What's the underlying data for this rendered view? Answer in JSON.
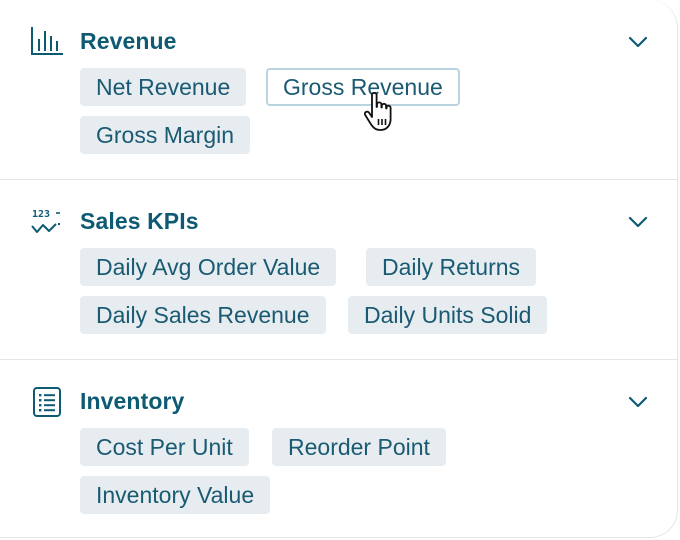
{
  "sections": [
    {
      "title": "Revenue",
      "icon": "bar-chart-icon",
      "tags": [
        "Net Revenue",
        "Gross Revenue",
        "Gross Margin"
      ]
    },
    {
      "title": "Sales KPIs",
      "icon": "numeric-trend-icon",
      "tags": [
        "Daily Avg Order Value",
        "Daily Returns",
        "Daily Sales Revenue",
        "Daily Units Solid"
      ]
    },
    {
      "title": "Inventory",
      "icon": "list-document-icon",
      "tags": [
        "Cost Per Unit",
        "Reorder Point",
        "Inventory Value"
      ]
    }
  ],
  "hovered_tag": "Gross Revenue",
  "cursor": "hand-pointer-icon",
  "colors": {
    "accent": "#0e5a73",
    "tag_bg": "#e6ecf0",
    "tag_text": "#1a5a72",
    "hover_border": "#b9d4de",
    "divider": "#e3e6e8"
  }
}
